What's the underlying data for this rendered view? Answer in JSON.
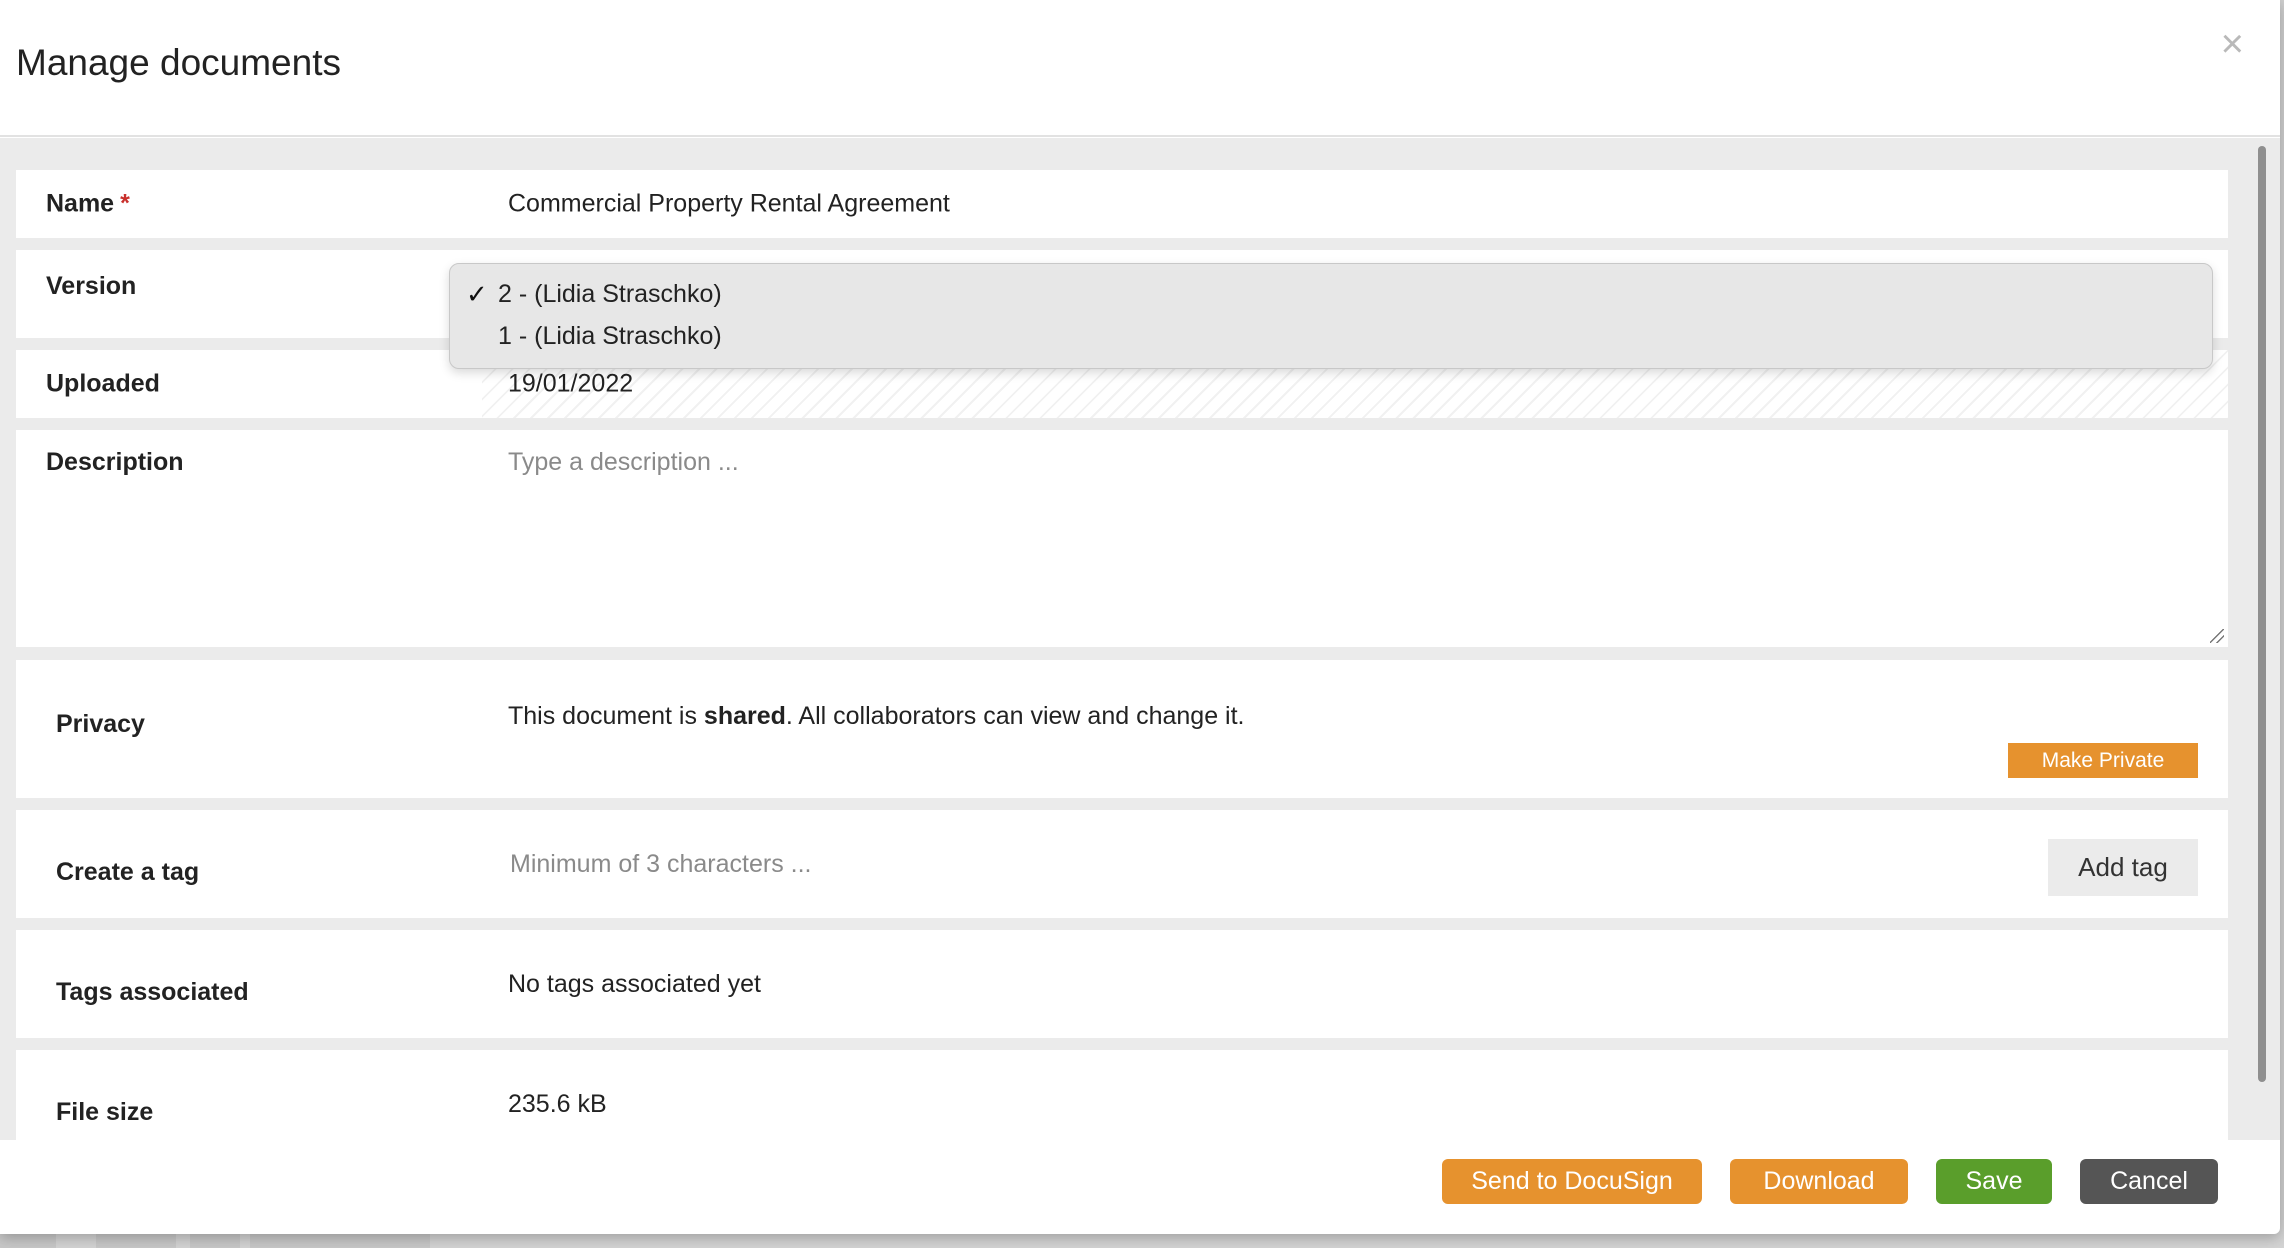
{
  "dialog": {
    "title": "Manage documents",
    "close_symbol": "×"
  },
  "form": {
    "name": {
      "label": "Name",
      "required_mark": "*",
      "value": "Commercial Property Rental Agreement"
    },
    "version": {
      "label": "Version",
      "options": [
        {
          "text": "2 - (Lidia Straschko)",
          "selected": true
        },
        {
          "text": "1 - (Lidia Straschko)",
          "selected": false
        }
      ],
      "check_symbol": "✓"
    },
    "uploaded": {
      "label": "Uploaded",
      "value": "19/01/2022"
    },
    "description": {
      "label": "Description",
      "placeholder": "Type a description ..."
    },
    "privacy": {
      "label": "Privacy",
      "text_before": "This document is ",
      "text_bold": "shared",
      "text_after": ". All collaborators can view and change it.",
      "button": "Make Private"
    },
    "create_tag": {
      "label": "Create a tag",
      "placeholder": "Minimum of 3 characters ...",
      "button": "Add tag"
    },
    "tags_associated": {
      "label": "Tags associated",
      "value": "No tags associated yet"
    },
    "file_size": {
      "label": "File size",
      "value": "235.6 kB"
    }
  },
  "footer": {
    "docusign": "Send to DocuSign",
    "download": "Download",
    "save": "Save",
    "cancel": "Cancel"
  },
  "colors": {
    "orange": "#e6922e",
    "green": "#5a9e2b",
    "dark": "#555555",
    "required": "#c9302c"
  }
}
